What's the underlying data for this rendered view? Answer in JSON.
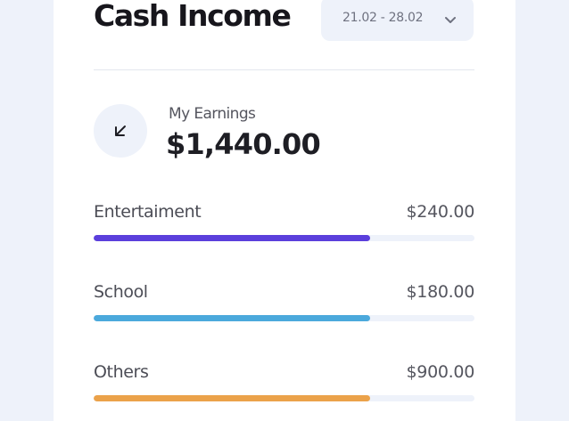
{
  "header": {
    "title": "Cash Income",
    "date_range": "21.02 - 28.02"
  },
  "earnings": {
    "label": "My Earnings",
    "value": "$1,440.00",
    "icon": "arrow-down-left-icon"
  },
  "categories": [
    {
      "name": "Entertaiment",
      "amount": "$240.00",
      "progress": 0.725,
      "color": "#5b3fdc"
    },
    {
      "name": "School",
      "amount": "$180.00",
      "progress": 0.725,
      "color": "#4ba9dc"
    },
    {
      "name": "Others",
      "amount": "$900.00",
      "progress": 0.725,
      "color": "#eba24a"
    }
  ],
  "colors": {
    "page_background": "#eef2fa",
    "card_background": "#ffffff",
    "track": "#eef2fa"
  }
}
